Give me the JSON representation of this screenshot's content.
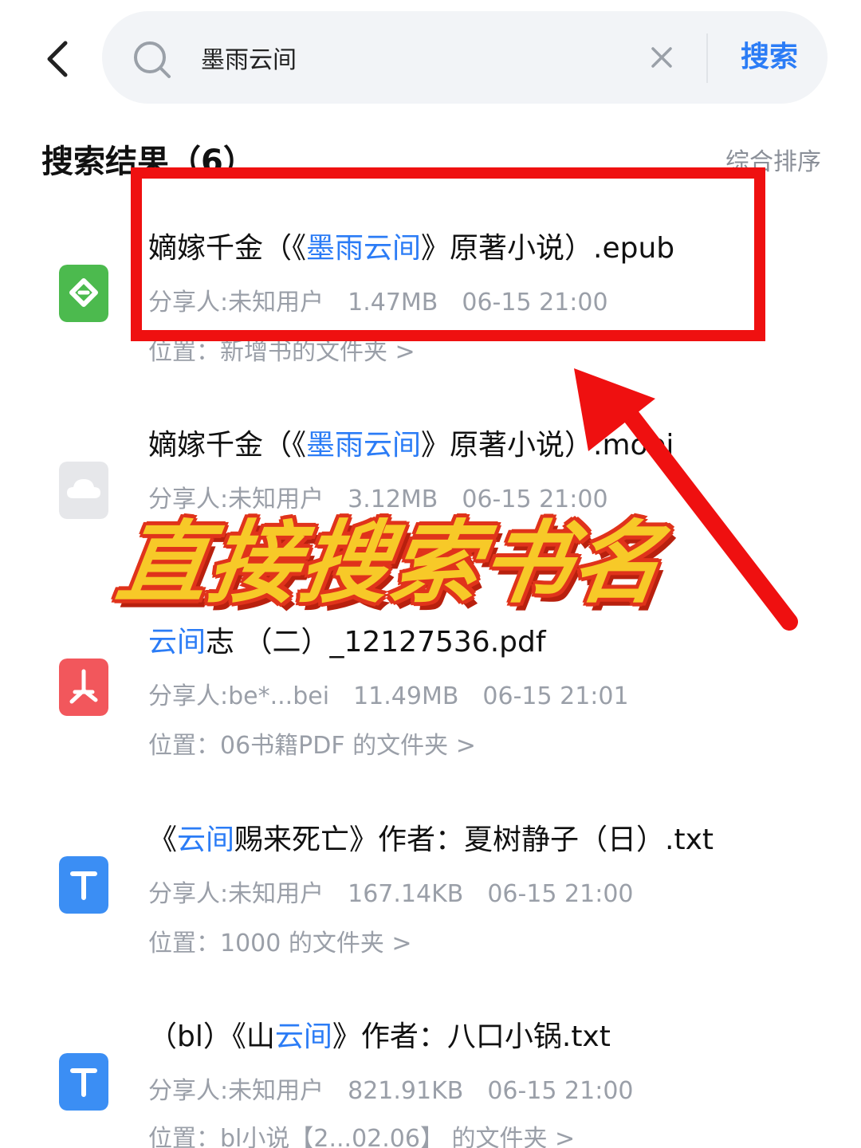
{
  "search": {
    "query": "墨雨云间",
    "button_label": "搜索"
  },
  "results_header": {
    "title": "搜索结果（6）",
    "sort_label": "综合排序"
  },
  "results": [
    {
      "icon": "epub-icon",
      "icon_color": "#4cba4e",
      "name_prefix": "嫡嫁千金（《",
      "name_highlight": "墨雨云间",
      "name_suffix": "》原著小说）.epub",
      "sharer": "分享人:未知用户",
      "size": "1.47MB",
      "time": "06-15 21:00",
      "location": "位置：新增书的文件夹 >"
    },
    {
      "icon": "cloud-file-icon",
      "icon_color": "#e6e7ea",
      "name_prefix": "嫡嫁千金（《",
      "name_highlight": "墨雨云间",
      "name_suffix": "》原著小说）.mobi",
      "sharer": "分享人:未知用户",
      "size": "3.12MB",
      "time": "06-15 21:00",
      "location": ""
    },
    {
      "icon": "pdf-icon",
      "icon_color": "#f2575c",
      "name_prefix": "",
      "name_highlight": "云间",
      "name_suffix": "志 （二）_12127536.pdf",
      "sharer": "分享人:be*...bei",
      "size": "11.49MB",
      "time": "06-15 21:01",
      "location": "位置：06书籍PDF 的文件夹 >"
    },
    {
      "icon": "txt-icon",
      "icon_color": "#3b8ef4",
      "name_prefix": "《",
      "name_highlight": "云间",
      "name_suffix": "赐来死亡》作者：夏树静子（日）.txt",
      "sharer": "分享人:未知用户",
      "size": "167.14KB",
      "time": "06-15 21:00",
      "location": "位置：1000 的文件夹 >"
    },
    {
      "icon": "txt-icon",
      "icon_color": "#3b8ef4",
      "name_prefix": "（bl）《山",
      "name_highlight": "云间",
      "name_suffix": "》作者：八口小锅.txt",
      "sharer": "分享人:未知用户",
      "size": "821.91KB",
      "time": "06-15 21:00",
      "location": "位置：bl小说【2...02.06】 的文件夹 >"
    }
  ],
  "overlay": {
    "caption": "直接搜索书名",
    "highlight_color": "#ef1010",
    "caption_color": "#f7c928"
  },
  "colors": {
    "accent": "#2b7cf6",
    "muted": "#9a9fa8"
  }
}
